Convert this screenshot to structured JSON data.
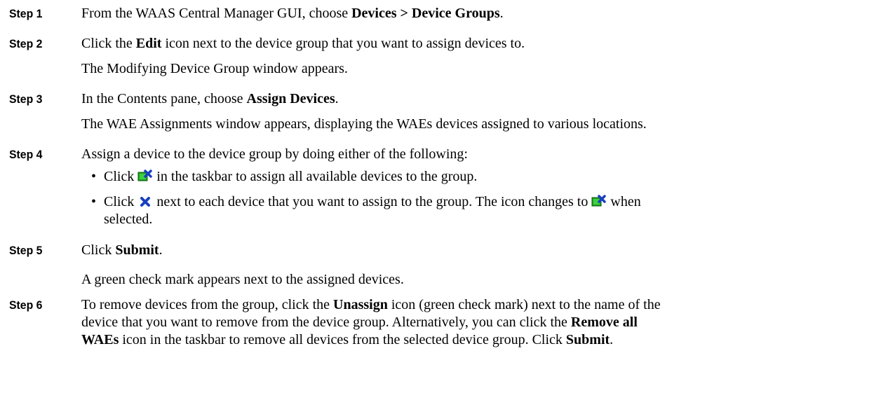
{
  "steps": [
    {
      "label": "Step 1",
      "pre": "From the WAAS Central Manager GUI, choose ",
      "bold": "Devices > Device Groups",
      "post": "."
    },
    {
      "label": "Step 2",
      "pre": "Click the ",
      "bold": "Edit",
      "post": " icon next to the device group that you want to assign devices to.",
      "note": "The Modifying Device Group window appears."
    },
    {
      "label": "Step 3",
      "pre": "In the Contents pane, choose ",
      "bold": "Assign Devices",
      "post": ".",
      "note": "The WAE Assignments window appears, displaying the WAEs devices assigned to various locations."
    },
    {
      "label": "Step 4",
      "text": "Assign a device to the device group by doing either of the following:",
      "bullet1": {
        "pre": "Click ",
        "post": " in the taskbar to assign all available devices to the group."
      },
      "bullet2": {
        "pre": "Click ",
        "mid": " next to each device that you want to assign to the group. The icon changes to ",
        "post": " when",
        "cont": "selected."
      }
    },
    {
      "label": "Step 5",
      "pre": "Click ",
      "bold": "Submit",
      "post": ".",
      "note": "A green check mark appears next to the assigned devices."
    },
    {
      "label": "Step 6",
      "line1_pre": "To remove devices from the group, click the ",
      "line1_bold": "Unassign",
      "line1_post": " icon (green check mark) next to the name of the",
      "line2_pre": "device that you want to remove from the device group. Alternatively, you can click the ",
      "line2_bold": "Remove all",
      "line3_bold": "WAEs",
      "line3_mid": " icon in the taskbar to remove all devices from the selected device group. Click ",
      "line3_bold2": "Submit",
      "line3_post": "."
    }
  ],
  "icons": {
    "assign_all": "assign-all-icon",
    "unassigned": "blue-x-icon",
    "assigned": "assign-all-icon"
  },
  "colors": {
    "green": "#1fa01f",
    "blue": "#1840c0"
  }
}
